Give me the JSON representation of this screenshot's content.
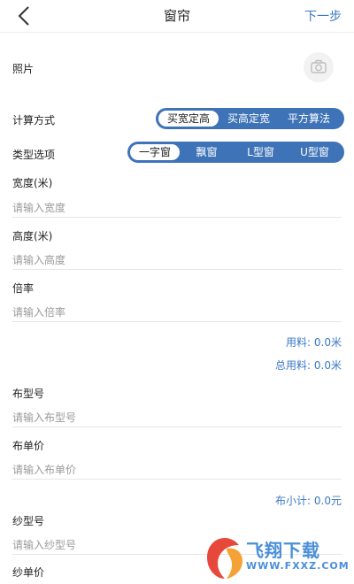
{
  "header": {
    "title": "窗帘",
    "next_label": "下一步"
  },
  "photo": {
    "label": "照片"
  },
  "calc_method": {
    "label": "计算方式",
    "options": [
      "买宽定高",
      "买高定宽",
      "平方算法"
    ],
    "selected": "买宽定高"
  },
  "type_option": {
    "label": "类型选项",
    "options": [
      "一字窗",
      "飘窗",
      "L型窗",
      "U型窗"
    ],
    "selected": "一字窗"
  },
  "fields": {
    "width": {
      "label": "宽度(米)",
      "placeholder": "请输入宽度"
    },
    "height": {
      "label": "高度(米)",
      "placeholder": "请输入高度"
    },
    "ratio": {
      "label": "倍率",
      "placeholder": "请输入倍率"
    },
    "fabric_model": {
      "label": "布型号",
      "placeholder": "请输入布型号"
    },
    "fabric_price": {
      "label": "布单价",
      "placeholder": "请输入布单价"
    },
    "gauze_model": {
      "label": "纱型号",
      "placeholder": "请输入纱型号"
    },
    "gauze_price": {
      "label": "纱单价"
    }
  },
  "stats": {
    "material": "用料: 0.0米",
    "total_material": "总用料: 0.0米",
    "fabric_subtotal": "布小计: 0.0元"
  },
  "watermark": {
    "text": "飞翔下载",
    "sub": "WWW.FXXZ.COM"
  },
  "colors": {
    "accent": "#3a78c4",
    "segment": "#3f73b7"
  }
}
